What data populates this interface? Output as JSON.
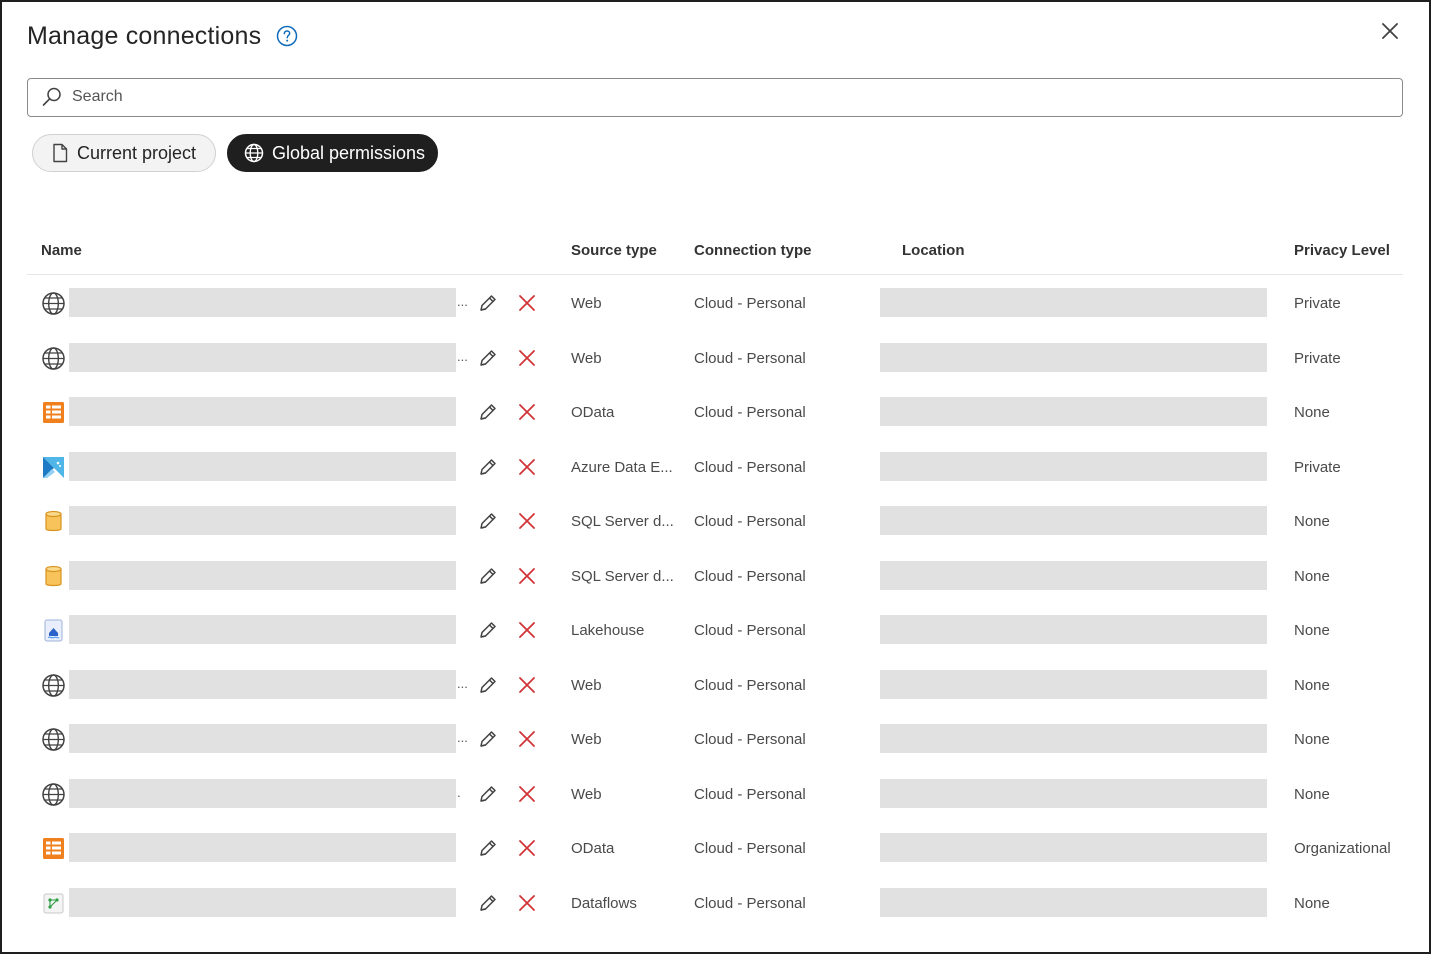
{
  "dialog": {
    "title": "Manage connections",
    "help_icon": "question-circle-icon",
    "close_icon": "close-icon"
  },
  "search": {
    "placeholder": "Search",
    "value": ""
  },
  "tabs": [
    {
      "label": "Current project",
      "icon": "document-icon",
      "selected": false
    },
    {
      "label": "Global permissions",
      "icon": "globe-icon",
      "selected": true
    }
  ],
  "table": {
    "columns": {
      "name": "Name",
      "source_type": "Source type",
      "connection_type": "Connection type",
      "location": "Location",
      "privacy_level": "Privacy Level"
    },
    "rows": [
      {
        "icon": "globe-icon",
        "truncated": "...",
        "source_type": "Web",
        "connection_type": "Cloud - Personal",
        "privacy_level": "Private"
      },
      {
        "icon": "globe-icon",
        "truncated": "...",
        "source_type": "Web",
        "connection_type": "Cloud - Personal",
        "privacy_level": "Private"
      },
      {
        "icon": "odata-icon",
        "truncated": "",
        "source_type": "OData",
        "connection_type": "Cloud - Personal",
        "privacy_level": "None"
      },
      {
        "icon": "azure-data-explorer-icon",
        "truncated": "",
        "source_type": "Azure Data E...",
        "connection_type": "Cloud - Personal",
        "privacy_level": "Private"
      },
      {
        "icon": "database-icon",
        "truncated": "",
        "source_type": "SQL Server d...",
        "connection_type": "Cloud - Personal",
        "privacy_level": "None"
      },
      {
        "icon": "database-icon",
        "truncated": "",
        "source_type": "SQL Server d...",
        "connection_type": "Cloud - Personal",
        "privacy_level": "None"
      },
      {
        "icon": "lakehouse-icon",
        "truncated": "",
        "source_type": "Lakehouse",
        "connection_type": "Cloud - Personal",
        "privacy_level": "None"
      },
      {
        "icon": "globe-icon",
        "truncated": "...",
        "source_type": "Web",
        "connection_type": "Cloud - Personal",
        "privacy_level": "None"
      },
      {
        "icon": "globe-icon",
        "truncated": "...",
        "source_type": "Web",
        "connection_type": "Cloud - Personal",
        "privacy_level": "None"
      },
      {
        "icon": "globe-icon",
        "truncated": ".",
        "source_type": "Web",
        "connection_type": "Cloud - Personal",
        "privacy_level": "None"
      },
      {
        "icon": "odata-icon",
        "truncated": "",
        "source_type": "OData",
        "connection_type": "Cloud - Personal",
        "privacy_level": "Organizational"
      },
      {
        "icon": "dataflows-icon",
        "truncated": "",
        "source_type": "Dataflows",
        "connection_type": "Cloud - Personal",
        "privacy_level": "None"
      }
    ]
  },
  "colors": {
    "accent": "#0f6cbd",
    "delete": "#d13438",
    "odata": "#f0801e",
    "database": "#f2b133",
    "selected_pill": "#1f1f1f",
    "redaction": "#e1e1e1"
  }
}
